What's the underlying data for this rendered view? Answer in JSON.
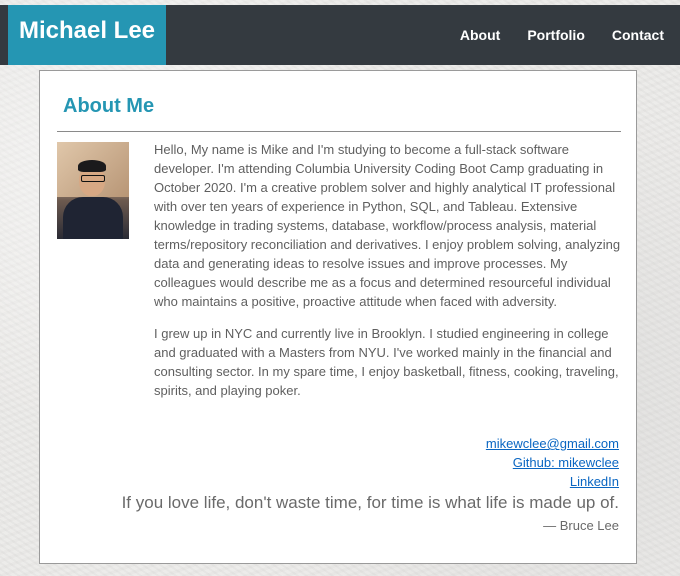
{
  "brand": {
    "name": "Michael Lee"
  },
  "nav": {
    "items": [
      "About",
      "Portfolio",
      "Contact"
    ]
  },
  "about": {
    "title": "About Me",
    "paragraphs": [
      "Hello, My name is Mike and I'm studying to become a full-stack software developer. I'm attending Columbia University Coding Boot Camp graduating in October 2020. I'm a creative problem solver and highly analytical IT professional with over ten years of experience in Python, SQL, and Tableau. Extensive knowledge in trading systems, database, workflow/process analysis, material terms/repository reconciliation and derivatives. I enjoy problem solving, analyzing data and generating ideas to resolve issues and improve processes. My colleagues would describe me as a focus and determined resourceful individual who maintains a positive, proactive attitude when faced with adversity.",
      "I grew up in NYC and currently live in Brooklyn. I studied engineering in college and graduated with a Masters from NYU. I've worked mainly in the financial and consulting sector. In my spare time, I enjoy basketball, fitness, cooking, traveling, spirits, and playing poker."
    ],
    "links": {
      "email": "mikewclee@gmail.com",
      "github": "Github: mikewclee",
      "linkedin": "LinkedIn"
    },
    "quote": "If you love life, don't waste time, for time is what life is made up of.",
    "quote_author": "— Bruce Lee"
  },
  "colors": {
    "accent": "#2596b3",
    "navbar": "#343a40",
    "link": "#0a66c2"
  },
  "icons": {
    "photo": "profile-photo"
  }
}
